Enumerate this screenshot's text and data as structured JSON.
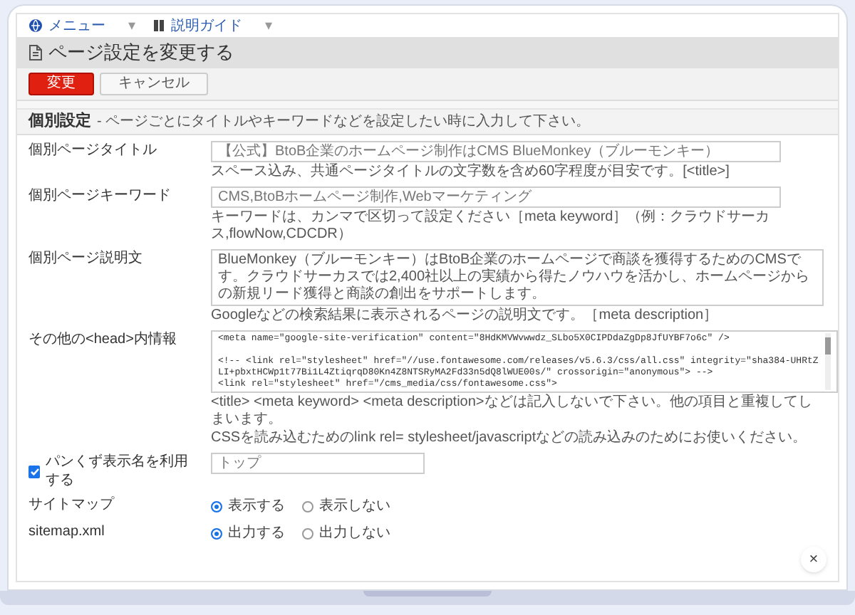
{
  "top_tabs": [
    {
      "label": "メニュー",
      "caret": "▾"
    },
    {
      "label": "説明ガイド",
      "caret": "▾"
    }
  ],
  "page_title": "ページ設定を変更する",
  "buttons": [
    {
      "kind": "primary",
      "label": "変更"
    },
    {
      "kind": "secondary",
      "label": "キャンセル"
    }
  ],
  "section": {
    "title": "個別設定",
    "note": "- ページごとにタイトルやキーワードなどを設定したい時に入力して下さい。"
  },
  "fields": [
    {
      "kind": "text",
      "label": "個別ページタイトル",
      "value": "【公式】BtoB企業のホームページ制作はCMS BlueMonkey（ブルーモンキー）",
      "help": [
        "スペース込み、共通ページタイトルの文字数を含め60字程度が目安です。[<title>]"
      ]
    },
    {
      "kind": "text",
      "label": "個別ページキーワード",
      "value": "CMS,BtoBホームページ制作,Webマーケティング",
      "help": [
        "キーワードは、カンマで区切って設定ください［meta keyword］（例：クラウドサーカス,flowNow,CDCDR）"
      ]
    },
    {
      "kind": "textarea",
      "label": "個別ページ説明文",
      "value": "BlueMonkey（ブルーモンキー）はBtoB企業のホームページで商談を獲得するためのCMSです。クラウドサーカスでは2,400社以上の実績から得たノウハウを活かし、ホームページからの新規リード獲得と商談の創出をサポートします。",
      "help": [
        "Googleなどの検索結果に表示されるページの説明文です。［meta description］"
      ]
    },
    {
      "kind": "code",
      "label": "その他の<head>内情報",
      "paragraphs": [
        "<meta name=\"google-site-verification\" content=\"8HdKMVWvwwdz_SLbo5X0CIPDdaZgDp8JfUYBF7o6c\" />",
        "<!-- <link rel=\"stylesheet\" href=\"//use.fontawesome.com/releases/v5.6.3/css/all.css\" integrity=\"sha384-UHRtZLI+pbxtHCWp1t77Bi1L4ZtiqrqD80Kn4Z8NTSRyMA2Fd33n5dQ8lWUE00s/\" crossorigin=\"anonymous\"> -->",
        "<link rel=\"stylesheet\" href=\"/cms_media/css/fontawesome.css\">"
      ],
      "help": [
        "<title> <meta keyword> <meta description>などは記入しないで下さい。他の項目と重複してしまいます。",
        "CSSを読み込むためのlink rel= stylesheet/javascriptなどの読み込みのためにお使いください。"
      ]
    },
    {
      "kind": "checkbox",
      "label": "パンくず表示名を利用する",
      "checked": true,
      "value": "トップ"
    },
    {
      "kind": "radio",
      "label": "サイトマップ",
      "options": [
        {
          "label": "表示する",
          "selected": true
        },
        {
          "label": "表示しない",
          "selected": false
        }
      ]
    },
    {
      "kind": "radio",
      "label": "sitemap.xml",
      "options": [
        {
          "label": "出力する",
          "selected": true
        },
        {
          "label": "出力しない",
          "selected": false
        }
      ]
    }
  ],
  "close_button": "×"
}
